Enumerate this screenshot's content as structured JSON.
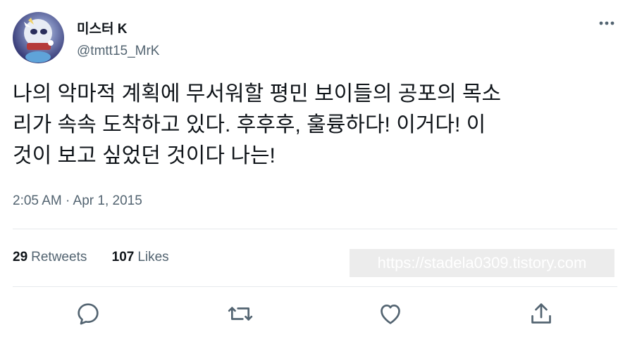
{
  "user": {
    "display_name": "미스터 K",
    "handle": "@tmtt15_MrK"
  },
  "tweet": {
    "text": "나의 악마적 계획에 무서워할 평민 보이들의 공포의 목소\n리가 속속 도착하고 있다. 후후후, 훌륭하다! 이거다! 이\n것이 보고 싶었던 것이다 나는!",
    "timestamp": "2:05 AM · Apr 1, 2015"
  },
  "stats": {
    "retweets_count": "29",
    "retweets_label": "Retweets",
    "likes_count": "107",
    "likes_label": "Likes"
  },
  "watermark": "https://stadela0309.tistory.com",
  "icons": {
    "more": "more-horizontal-icon",
    "reply": "reply-icon",
    "retweet": "retweet-icon",
    "like": "heart-icon",
    "share": "share-icon"
  },
  "colors": {
    "text": "#0f1419",
    "secondary": "#536471",
    "divider": "#e6e9ec"
  }
}
